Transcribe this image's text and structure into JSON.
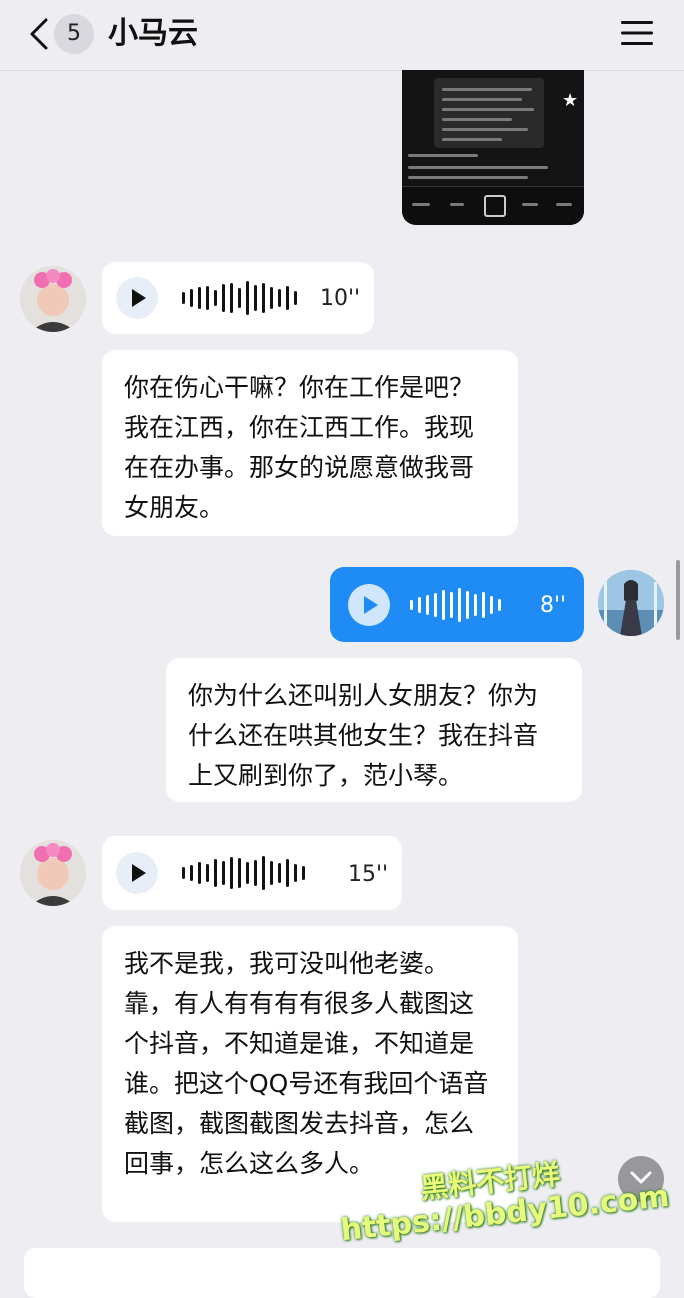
{
  "header": {
    "unread_count": "5",
    "title": "小马云"
  },
  "icons": {
    "back": "chevron-left-icon",
    "menu": "hamburger-menu-icon",
    "play": "play-icon",
    "scroll_down": "chevron-down-icon"
  },
  "colors": {
    "sent_bubble": "#1f8cf5",
    "background": "#eeeef2"
  },
  "messages": [
    {
      "side": "left",
      "type": "voice",
      "duration": "10''"
    },
    {
      "side": "left",
      "type": "text",
      "text": "你在伤心干嘛？你在工作是吧？我在江西，你在江西工作。我现在在办事。那女的说愿意做我哥女朋友。"
    },
    {
      "side": "right",
      "type": "voice",
      "duration": "8''"
    },
    {
      "side": "right",
      "type": "text",
      "text": "你为什么还叫别人女朋友？你为什么还在哄其他女生？我在抖音上又刷到你了，范小琴。"
    },
    {
      "side": "left",
      "type": "voice",
      "duration": "15''"
    },
    {
      "side": "left",
      "type": "text",
      "text": "我不是我，我可没叫他老婆。靠，有人有有有有很多人截图这个抖音，不知道是谁，不知道是谁。把这个QQ号还有我回个语音截图，截图截图发去抖音，怎么回事，怎么这么多人。"
    }
  ],
  "watermark": {
    "line1": "黑料不打烊",
    "line2": "https://bbdy10.com"
  }
}
